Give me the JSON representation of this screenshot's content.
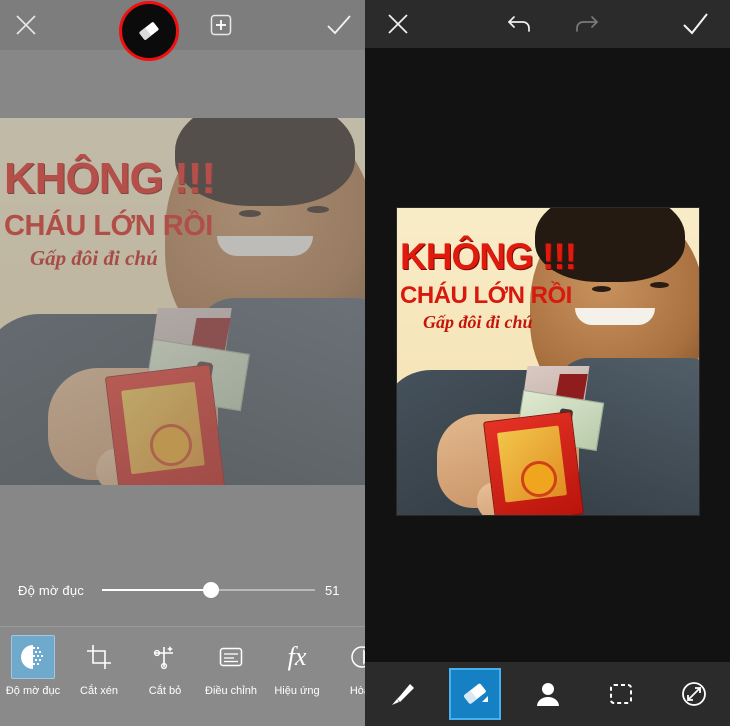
{
  "left_panel": {
    "name": "photo-editor-opacity-screen",
    "topbar": {
      "close_label": "✕",
      "eraser_label": "eraser-tool",
      "add_layer_label": "+",
      "confirm_label": "✓",
      "highlight_color": "#f01010"
    },
    "slider": {
      "label": "Độ mờ đục",
      "value": "51",
      "percent": 51,
      "min": "0",
      "max": "100"
    },
    "toolbar": {
      "items": [
        {
          "label": "Độ mờ đục",
          "icon": "opacity-icon",
          "selected": true
        },
        {
          "label": "Cắt xén",
          "icon": "crop-icon",
          "selected": false
        },
        {
          "label": "Cắt bỏ",
          "icon": "cutout-icon",
          "selected": false
        },
        {
          "label": "Điều chỉnh",
          "icon": "adjust-icon",
          "selected": false
        },
        {
          "label": "Hiệu ứng",
          "icon": "fx-icon",
          "selected": false
        },
        {
          "label": "Hòa t",
          "icon": "blend-icon",
          "selected": false
        }
      ],
      "selected_accent": "#6fa9cb"
    },
    "canvas": {
      "background": "#878787",
      "image_opacity": "51%"
    }
  },
  "right_panel": {
    "name": "photo-editor-eraser-screen",
    "topbar": {
      "close_label": "✕",
      "undo_label": "undo",
      "redo_label": "redo",
      "confirm_label": "✓"
    },
    "toolbar": {
      "items": [
        {
          "label": "brush",
          "icon": "brush-icon",
          "selected": false
        },
        {
          "label": "eraser",
          "icon": "eraser-icon",
          "selected": true
        },
        {
          "label": "portrait",
          "icon": "person-icon",
          "selected": false
        },
        {
          "label": "selection",
          "icon": "marquee-icon",
          "selected": false
        },
        {
          "label": "restore",
          "icon": "transform-target-icon",
          "selected": false
        }
      ],
      "selected_accent": "#1581c4"
    },
    "canvas": {
      "background": "#121212"
    }
  },
  "artwork": {
    "headline": "KHÔNG !!!",
    "subline": "CHÁU LỚN RỒI",
    "caption": "Gấp đôi đi chú",
    "headline_color": "#e01b0e",
    "background_color": "#f6e6bb",
    "description": "man-holding-red-envelope"
  }
}
